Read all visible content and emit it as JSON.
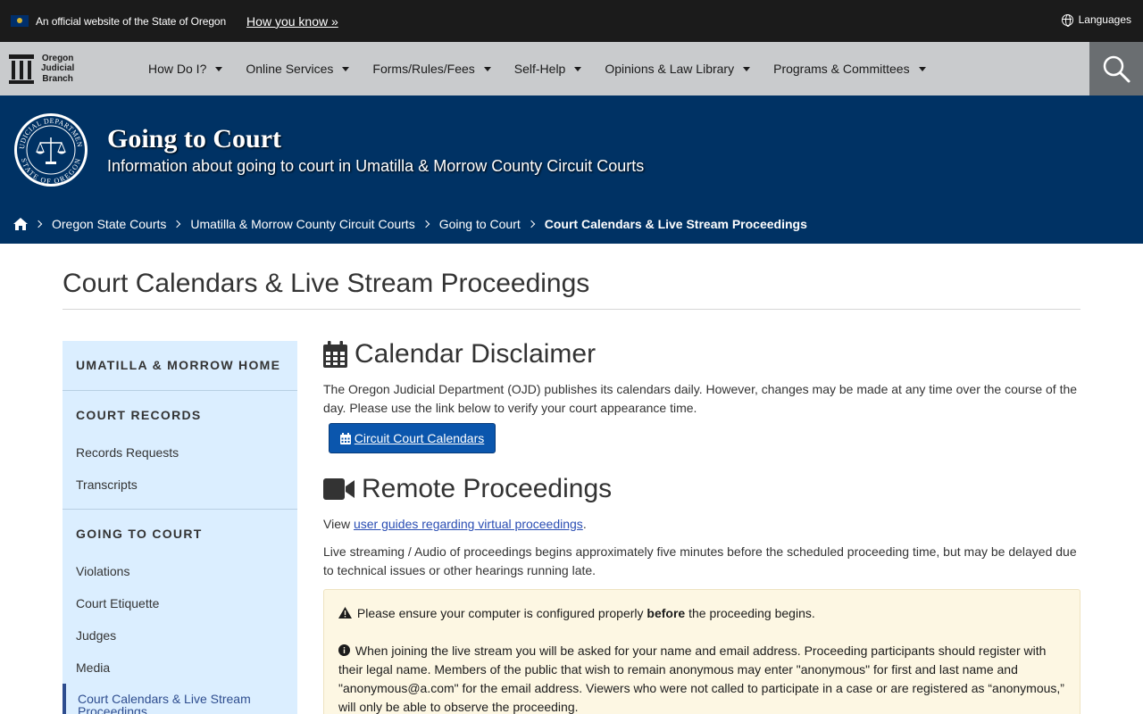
{
  "banner": {
    "official_text": "An official website of the State of Oregon",
    "how_you_know": "How you know »",
    "languages": "Languages"
  },
  "nav": {
    "logo_lines": [
      "Oregon",
      "Judicial",
      "Branch"
    ],
    "items": [
      {
        "label": "How Do I?"
      },
      {
        "label": "Online Services"
      },
      {
        "label": "Forms/Rules/Fees"
      },
      {
        "label": "Self-Help"
      },
      {
        "label": "Opinions & Law Library"
      },
      {
        "label": "Programs & Committees"
      }
    ]
  },
  "hero": {
    "title": "Going to Court",
    "subtitle": "Information about going to court in Umatilla & Morrow County Circuit Courts",
    "seal_text_top": "JUDICIAL DEPARTMENT",
    "seal_text_bottom": "STATE OF OREGON"
  },
  "breadcrumb": {
    "items": [
      "Oregon State Courts",
      "Umatilla & Morrow County Circuit Courts",
      "Going to Court"
    ],
    "current": "Court Calendars & Live Stream Proceedings"
  },
  "page": {
    "title": "Court Calendars & Live Stream Proceedings"
  },
  "sidebar": {
    "home": "UMATILLA & MORROW HOME",
    "court_records": {
      "heading": "COURT RECORDS",
      "links": [
        "Records Requests",
        "Transcripts"
      ]
    },
    "going_to_court": {
      "heading": "GOING TO COURT",
      "links": [
        "Violations",
        "Court Etiquette",
        "Judges",
        "Media"
      ],
      "active": "Court Calendars & Live Stream Proceedings"
    }
  },
  "content": {
    "calendar_heading": "Calendar Disclaimer",
    "calendar_text": "The Oregon Judicial Department (OJD) publishes its calendars daily. However, changes may be made at any time over the course of the day. Please use the link below to verify your court appearance time.",
    "calendar_button": "Circuit Court Calendars",
    "remote_heading": "Remote Proceedings",
    "view_prefix": "View ",
    "view_link": "user guides regarding virtual proceedings",
    "view_suffix": ".",
    "live_text": "Live streaming / Audio of proceedings begins approximately five minutes before the scheduled proceeding time, but may be delayed due to technical issues or other hearings running late.",
    "alert_warning_pre": "Please ensure your computer is configured properly ",
    "alert_warning_bold": "before",
    "alert_warning_post": " the proceeding begins.",
    "alert_info": "When joining the live stream you will be asked for your name and email address. Proceeding participants should register with their legal name. Members of the public that wish to remain anonymous may enter \"anonymous\" for first and last name and \"anonymous@a.com\" for the email address. Viewers who were not called to participate in a case or are registered as “anonymous,” will only be able to observe the proceeding."
  },
  "colors": {
    "banner_bg": "#1b1b1b",
    "nav_bg": "#c9cbcd",
    "hero_bg": "#003264",
    "sidebar_bg": "#dbeeff",
    "button_bg": "#0b56ad",
    "alert_bg": "#fdf7e3"
  }
}
